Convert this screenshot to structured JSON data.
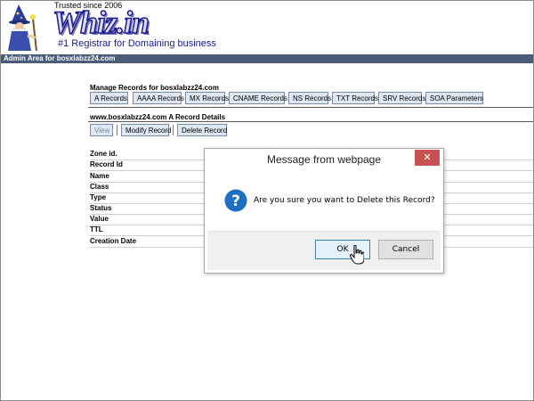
{
  "header": {
    "trusted": "Trusted since 2006",
    "logo_text": "Whiz.in",
    "tagline": "#1 Registrar for Domaining business",
    "wizard_icon": "wizard-mascot-icon"
  },
  "admin_bar": {
    "label": "Admin Area for bosxlabzz24.com"
  },
  "manage": {
    "title": "Manage Records for bosxlabzz24.com",
    "tabs": [
      "A Records",
      "AAAA Records",
      "MX Records",
      "CNAME Records",
      "NS Records",
      "TXT Records",
      "SRV Records",
      "SOA Parameters"
    ]
  },
  "details": {
    "title": "www.bosxlabzz24.com A Record Details",
    "actions": {
      "view": "View",
      "modify": "Modify Record",
      "delete": "Delete Record"
    },
    "fields": [
      "Zone id.",
      "Record Id",
      "Name",
      "Class",
      "Type",
      "Status",
      "Value",
      "TTL",
      "Creation Date"
    ]
  },
  "dialog": {
    "title": "Message from webpage",
    "message": "Are you sure you want to Delete this Record?",
    "ok": "OK",
    "cancel": "Cancel",
    "close_icon": "close-icon",
    "message_icon": "question-icon"
  },
  "colors": {
    "admin_bar": "#4a5c78",
    "close_button": "#c75050",
    "question_icon": "#1e6fc2"
  }
}
